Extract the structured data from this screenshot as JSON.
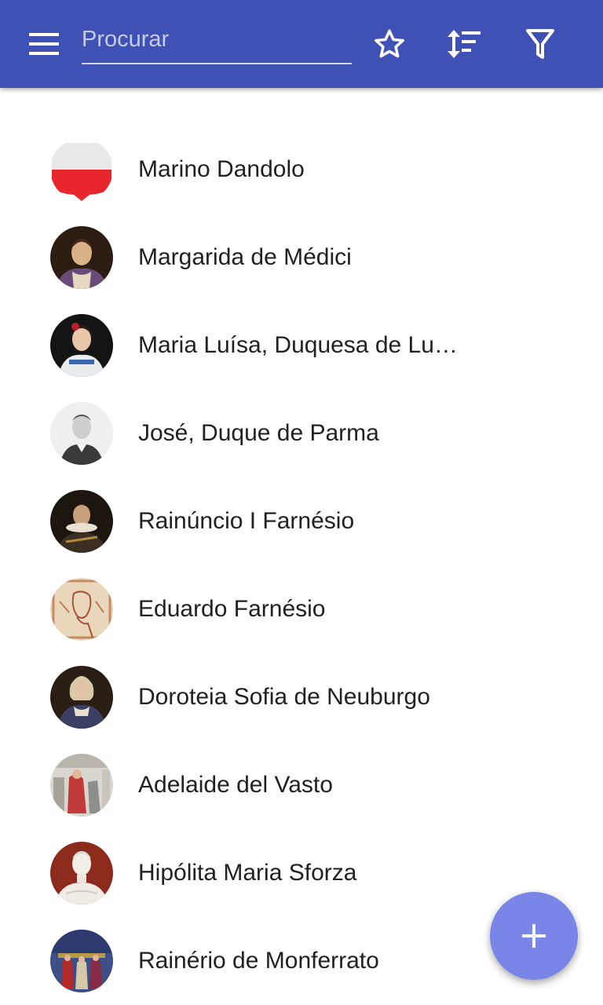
{
  "toolbar": {
    "search_placeholder": "Procurar",
    "colors": {
      "bar": "#3f51b5",
      "fab": "#7986e8"
    }
  },
  "list": {
    "items": [
      {
        "name": "Marino Dandolo",
        "avatar": "coat-of-arms"
      },
      {
        "name": "Margarida de Médici",
        "avatar": "portrait"
      },
      {
        "name": "Maria Luísa, Duquesa de Lu…",
        "avatar": "portrait"
      },
      {
        "name": "José, Duque de Parma",
        "avatar": "portrait"
      },
      {
        "name": "Rainúncio I Farnésio",
        "avatar": "portrait"
      },
      {
        "name": "Eduardo Farnésio",
        "avatar": "portrait"
      },
      {
        "name": "Doroteia Sofia de Neuburgo",
        "avatar": "portrait"
      },
      {
        "name": "Adelaide del Vasto",
        "avatar": "painting"
      },
      {
        "name": "Hipólita Maria Sforza",
        "avatar": "sculpture"
      },
      {
        "name": "Rainério de Monferrato",
        "avatar": "painting"
      }
    ]
  },
  "fab": {
    "icon": "plus-icon"
  }
}
